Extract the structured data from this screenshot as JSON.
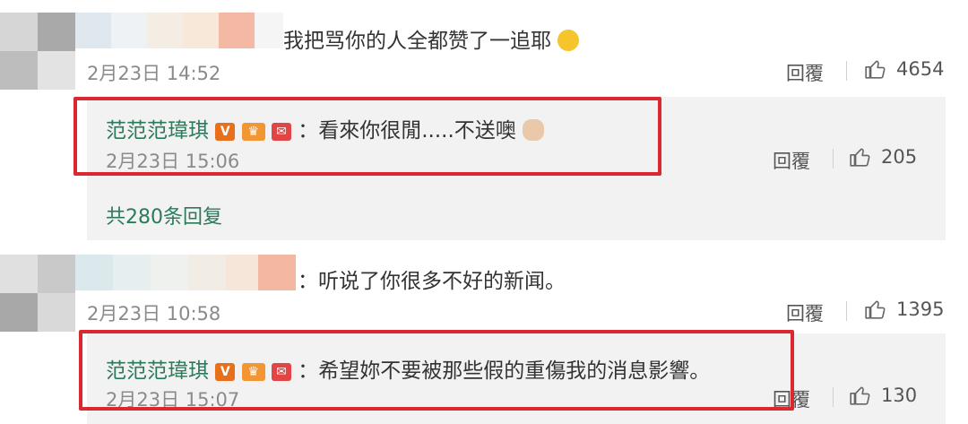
{
  "comments": [
    {
      "text": "我把骂你的人全都赞了一追耶",
      "emoji": "grinning-face-emoji",
      "time": "2月23日 14:52",
      "reply_label": "回覆",
      "likes": "4654",
      "reply": {
        "name": "范范范瑋琪",
        "separator": "：",
        "text": "看來你很閒.....不送噢",
        "emoji": "waving-hand-emoji",
        "time": "2月23日 15:06",
        "reply_label": "回覆",
        "likes": "205"
      },
      "more_replies": "共280条回复"
    },
    {
      "separator": "：",
      "text": "听说了你很多不好的新闻。",
      "time": "2月23日 10:58",
      "reply_label": "回覆",
      "likes": "1395",
      "reply": {
        "name": "范范范瑋琪",
        "separator": "：",
        "text": "希望妳不要被那些假的重傷我的消息影響。",
        "time": "2月23日 15:07",
        "reply_label": "回覆",
        "likes": "130"
      }
    }
  ],
  "colors": {
    "highlight": "#d9282f",
    "reply_name": "#2b7a5a",
    "reply_bg": "#f2f2f2"
  },
  "icons": {
    "like": "thumbs-up-icon",
    "verified": "verified-v-icon",
    "crown": "crown-badge-icon",
    "mail": "red-envelope-badge-icon"
  }
}
